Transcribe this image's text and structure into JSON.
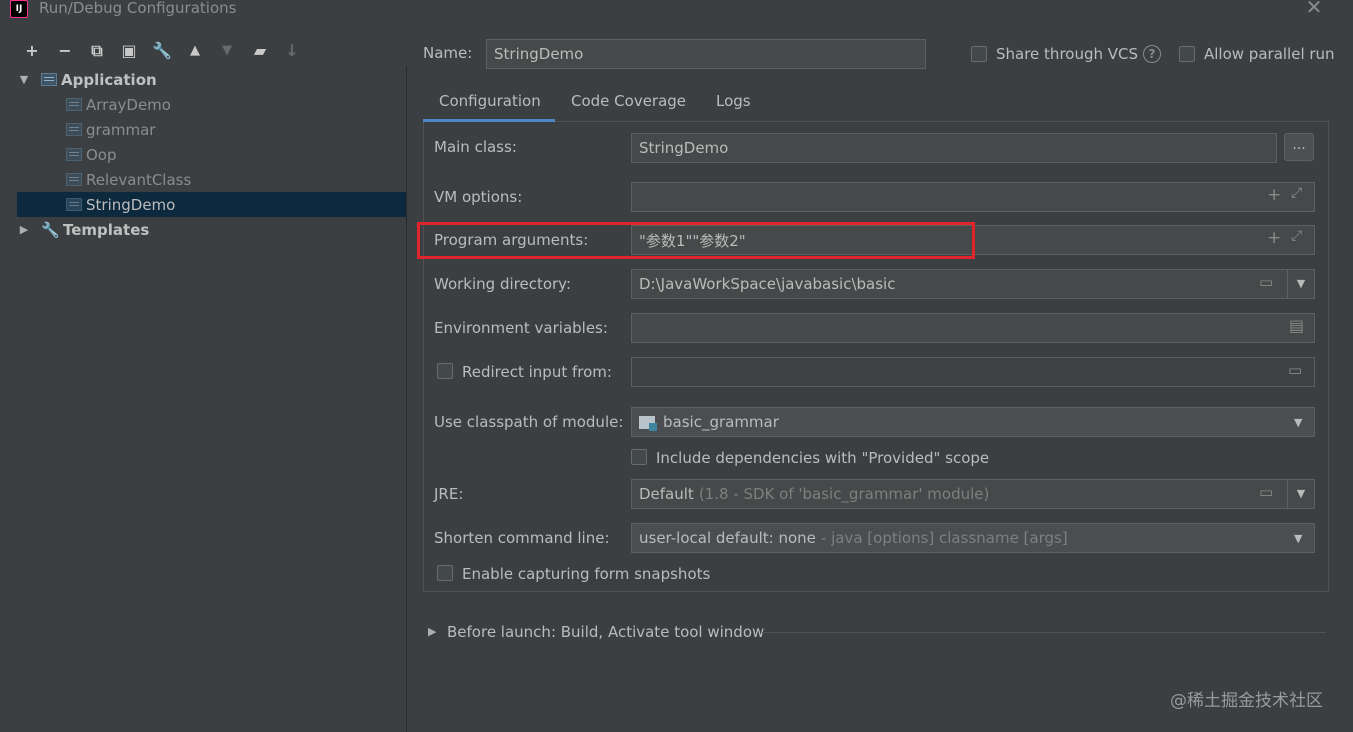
{
  "window": {
    "title": "Run/Debug Configurations",
    "logo_text": "IJ"
  },
  "toolbar": {
    "add": "+",
    "remove": "−",
    "copy": "⧉",
    "save": "▣",
    "edit_templates": "🔧",
    "move_up": "▲",
    "move_down": "▼",
    "new_folder": "▰",
    "sort": "↓"
  },
  "tree": {
    "application_label": "Application",
    "items": [
      {
        "label": "ArrayDemo"
      },
      {
        "label": "grammar"
      },
      {
        "label": "Oop"
      },
      {
        "label": "RelevantClass"
      },
      {
        "label": "StringDemo"
      }
    ],
    "templates_label": "Templates"
  },
  "header": {
    "name_label": "Name:",
    "name_value": "StringDemo",
    "share_vcs_label": "Share through VCS",
    "parallel_run_label": "Allow parallel run"
  },
  "tabs": [
    {
      "label": "Configuration",
      "active": true
    },
    {
      "label": "Code Coverage",
      "active": false
    },
    {
      "label": "Logs",
      "active": false
    }
  ],
  "form": {
    "main_class_label": "Main class:",
    "main_class_value": "StringDemo",
    "ellipsis": "...",
    "vm_options_label": "VM options:",
    "vm_options_value": "",
    "program_args_label": "Program arguments:",
    "program_args_value": "\"参数1\"\"参数2\"",
    "working_dir_label": "Working directory:",
    "working_dir_value": "D:\\JavaWorkSpace\\javabasic\\basic",
    "env_vars_label": "Environment variables:",
    "env_vars_value": "",
    "redirect_label": "Redirect input from:",
    "redirect_value": "",
    "classpath_label": "Use classpath of module:",
    "classpath_value": "basic_grammar",
    "include_deps_label": "Include dependencies with \"Provided\" scope",
    "jre_label": "JRE:",
    "jre_value": "Default",
    "jre_detail": "(1.8 - SDK of 'basic_grammar' module)",
    "shorten_label": "Shorten command line:",
    "shorten_value": "user-local default: none",
    "shorten_detail": "- java [options] classname [args]",
    "capture_label": "Enable capturing form snapshots"
  },
  "before_launch": {
    "label": "Before launch: Build, Activate tool window"
  },
  "watermark": "@稀土掘金技术社区",
  "colors": {
    "background": "#3c3f41",
    "selection": "#0d293e",
    "tab_accent": "#4a88c7",
    "highlight_box": "#e0242c"
  }
}
